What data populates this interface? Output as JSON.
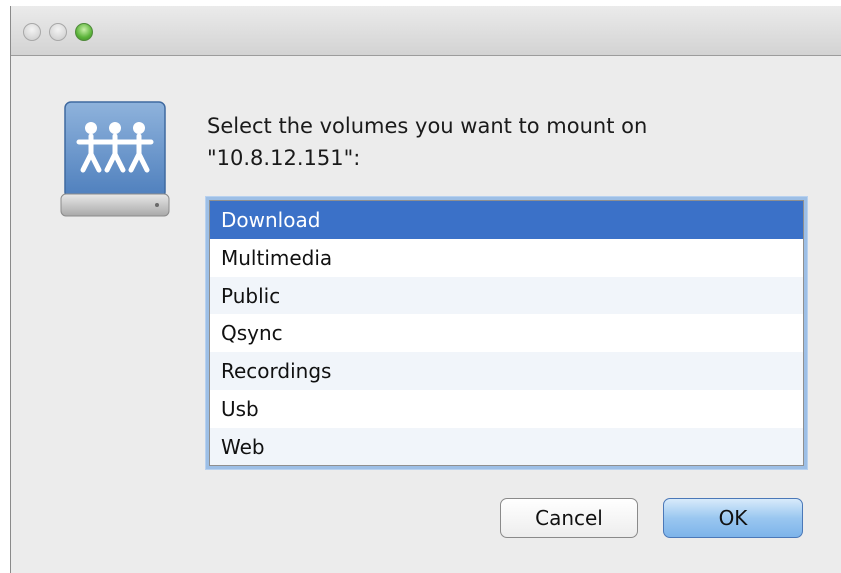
{
  "window": {
    "title": "",
    "controls": [
      "close-button",
      "minimize-button",
      "zoom-button"
    ]
  },
  "dialog": {
    "icon": "shared-server-icon",
    "prompt_line1": "Select the volumes you want to mount on",
    "prompt_line2": "\"10.8.12.151\":",
    "volumes": [
      {
        "label": "Download",
        "selected": true
      },
      {
        "label": "Multimedia",
        "selected": false
      },
      {
        "label": "Public",
        "selected": false
      },
      {
        "label": "Qsync",
        "selected": false
      },
      {
        "label": "Recordings",
        "selected": false
      },
      {
        "label": "Usb",
        "selected": false
      },
      {
        "label": "Web",
        "selected": false
      }
    ],
    "cancel_label": "Cancel",
    "ok_label": "OK"
  },
  "colors": {
    "selection": "#3b71c8",
    "default_button": "#9ac7f0",
    "zoom_button": "#5bb33a"
  }
}
